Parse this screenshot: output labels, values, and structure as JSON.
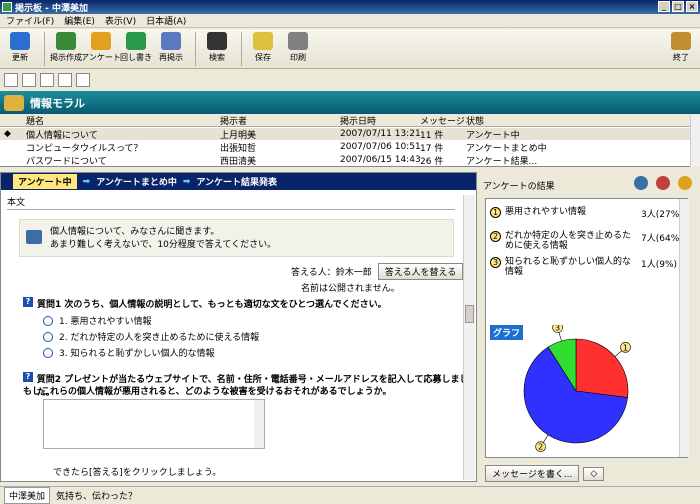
{
  "window": {
    "title": "掲示板 - 中澤美加"
  },
  "menu": [
    "ファイル(F)",
    "編集(E)",
    "表示(V)",
    "日本語(A)"
  ],
  "toolbar": [
    {
      "label": "更新",
      "icon": "refresh-icon",
      "color": "#2a6fd0"
    },
    {
      "label": "掲示作成",
      "icon": "new-post-icon",
      "color": "#3a8a3a"
    },
    {
      "label": "アンケート",
      "icon": "survey-icon",
      "color": "#e0a020"
    },
    {
      "label": "回し書き",
      "icon": "circulate-icon",
      "color": "#2a9a4a"
    },
    {
      "label": "再掲示",
      "icon": "repost-icon",
      "color": "#5a7abf"
    },
    {
      "label": "検索",
      "icon": "binoculars-icon",
      "color": "#333333"
    },
    {
      "label": "保存",
      "icon": "save-icon",
      "color": "#e0c040"
    },
    {
      "label": "印刷",
      "icon": "print-icon",
      "color": "#808080"
    },
    {
      "label": "終了",
      "icon": "exit-door-icon",
      "color": "#c09030"
    }
  ],
  "section": {
    "title": "情報モラル"
  },
  "grid": {
    "headers": [
      "題名",
      "掲示者",
      "掲示日時",
      "メッセージ",
      "状態"
    ],
    "rows": [
      {
        "title": "個人情報について",
        "poster": "上月明美",
        "date": "2007/07/11 13:21",
        "msgs": "11 件",
        "status": "アンケート中"
      },
      {
        "title": "コンピュータウイルスって？",
        "poster": "出張知哲",
        "date": "2007/07/06 10:51",
        "msgs": "17 件",
        "status": "アンケートまとめ中"
      },
      {
        "title": "パスワードについて",
        "poster": "西田清美",
        "date": "2007/06/15 14:43",
        "msgs": "26 件",
        "status": "アンケート結果..."
      }
    ]
  },
  "steps": [
    "アンケート中",
    "アンケートまとめ中",
    "アンケート結果発表"
  ],
  "body": {
    "label": "本文",
    "intro1": "個人情報について、みなさんに聞きます。",
    "intro2": "あまり難しく考えないで、10分程度で答えてください。",
    "respondent": "答える人：鈴木一郎",
    "change_btn": "答える人を替える",
    "name_note": "名前は公開されません。",
    "q1": "質問1  次のうち、個人情報の説明として、もっとも適切な文をひとつ選んでください。",
    "q1_opts": [
      "1. 悪用されやすい情報",
      "2. だれか特定の人を突き止めるために使える情報",
      "3. 知られると恥ずかしい個人的な情報"
    ],
    "q2a": "質問2  プレゼントが当たるウェブサイトで、名前・住所・電話番号・メールアドレスを記入して応募しました。",
    "q2b": "もしこれらの個人情報が悪用されると、どのような被害を受けるおそれがあるでしょうか。",
    "finish": "できたら[答える]をクリックしましょう。"
  },
  "results": {
    "title": "アンケートの結果",
    "items": [
      {
        "num": "1",
        "text": "悪用されやすい情報",
        "value": "3人(27%)"
      },
      {
        "num": "2",
        "text": "だれか特定の人を突き止めるために使える情報",
        "value": "7人(64%)"
      },
      {
        "num": "3",
        "text": "知られると恥ずかしい個人的な情報",
        "value": "1人(9%)"
      }
    ],
    "graph_label": "グラフ",
    "message_btn": "メッセージを書く..."
  },
  "chart_data": {
    "type": "pie",
    "categories": [
      "1",
      "2",
      "3"
    ],
    "values": [
      27,
      64,
      9
    ],
    "colors": [
      "#ff3030",
      "#3030ff",
      "#30dd30"
    ]
  },
  "status": {
    "user": "中澤美加",
    "text": "気持ち、伝わった？"
  }
}
